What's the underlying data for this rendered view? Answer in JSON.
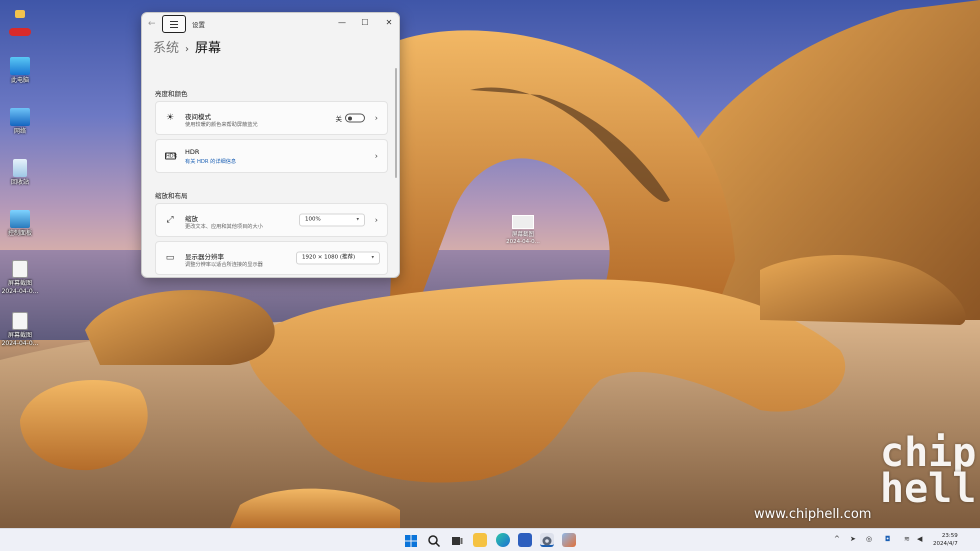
{
  "desktop": {
    "icons": [
      {
        "label": "此电脑"
      },
      {
        "label": "网络"
      },
      {
        "label": "回收站"
      },
      {
        "label": "控制面板"
      },
      {
        "label": "屏幕截图",
        "sub": "2024-04-0..."
      },
      {
        "label": "屏幕截图",
        "sub": "2024-04-0..."
      }
    ],
    "file": {
      "label": "屏幕截图",
      "sub": "2024-04-0..."
    }
  },
  "window": {
    "title": "设置",
    "breadcrumb": {
      "parent": "系统",
      "separator": "›",
      "current": "屏幕"
    },
    "controls": {
      "minimize": "—",
      "maximize": "☐",
      "close": "✕"
    },
    "sections": [
      {
        "title": "亮度和颜色",
        "cards": [
          {
            "title": "夜间模式",
            "subtitle": "使用较暖的颜色来帮助屏蔽蓝光",
            "toggle_label": "关"
          },
          {
            "title": "HDR",
            "subtitle": "有关 HDR 的详细信息"
          }
        ]
      },
      {
        "title": "缩放和布局",
        "cards": [
          {
            "title": "缩放",
            "subtitle": "更改文本、应用和其他项目的大小",
            "value": "100%"
          },
          {
            "title": "显示器分辨率",
            "subtitle": "调整分辨率以适合所连接的显示器",
            "value": "1920 × 1080 (推荐)"
          }
        ]
      }
    ]
  },
  "watermark": {
    "url": "www.chiphell.com",
    "logo": "chip hell"
  },
  "taskbar": {
    "tray_up": "^",
    "time": "23:59",
    "date": "2024/4/7"
  },
  "colors": {
    "accent": "#1a5fb4",
    "window_bg": "#f3f3f3",
    "taskbar_bg": "#eef0f7"
  }
}
